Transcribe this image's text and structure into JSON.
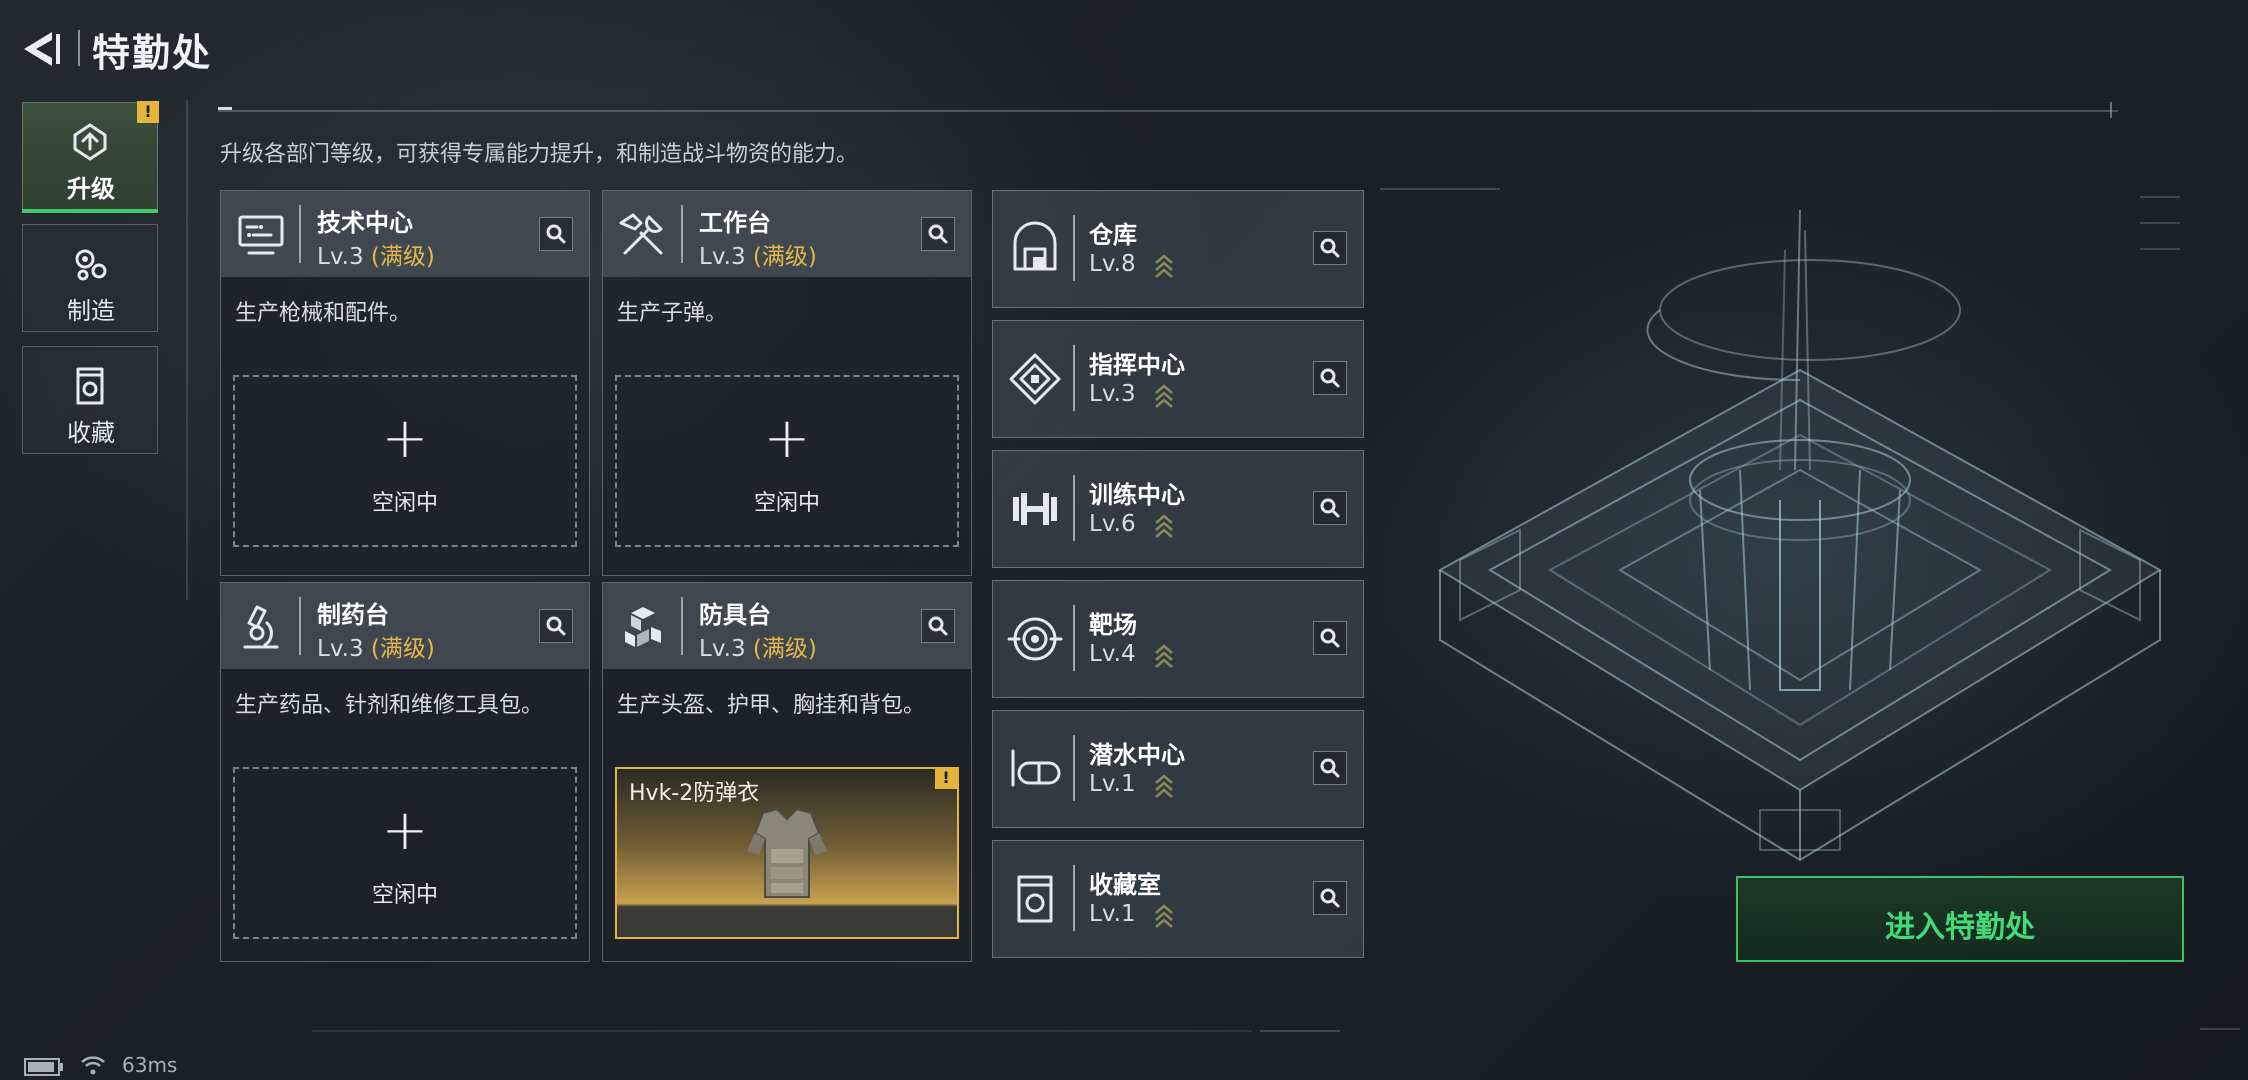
{
  "header": {
    "title": "特勤处"
  },
  "subtitle": "升级各部门等级，可获得专属能力提升，和制造战斗物资的能力。",
  "sidebar": {
    "tabs": [
      {
        "label": "升级",
        "icon": "upgrade-icon",
        "active": true,
        "alert": "!"
      },
      {
        "label": "制造",
        "icon": "gear-icon",
        "active": false
      },
      {
        "label": "收藏",
        "icon": "collection-icon",
        "active": false
      }
    ]
  },
  "departments": [
    {
      "name": "技术中心",
      "level": "Lv.3",
      "max_label": "(满级)",
      "desc": "生产枪械和配件。",
      "icon": "monitor-icon",
      "slot": {
        "plus": "+",
        "label": "空闲中"
      }
    },
    {
      "name": "工作台",
      "level": "Lv.3",
      "max_label": "(满级)",
      "desc": "生产子弹。",
      "icon": "tools-icon",
      "slot": {
        "plus": "+",
        "label": "空闲中"
      }
    },
    {
      "name": "制药台",
      "level": "Lv.3",
      "max_label": "(满级)",
      "desc": "生产药品、针剂和维修工具包。",
      "icon": "microscope-icon",
      "slot": {
        "plus": "+",
        "label": "空闲中"
      }
    },
    {
      "name": "防具台",
      "level": "Lv.3",
      "max_label": "(满级)",
      "desc": "生产头盔、护甲、胸挂和背包。",
      "icon": "armor-blocks-icon",
      "item": {
        "name": "Hvk-2防弹衣",
        "alert": "!"
      }
    }
  ],
  "facilities": [
    {
      "name": "仓库",
      "level": "Lv.8",
      "icon": "warehouse-icon"
    },
    {
      "name": "指挥中心",
      "level": "Lv.3",
      "icon": "command-icon"
    },
    {
      "name": "训练中心",
      "level": "Lv.6",
      "icon": "dumbbell-icon"
    },
    {
      "name": "靶场",
      "level": "Lv.4",
      "icon": "target-icon"
    },
    {
      "name": "潜水中心",
      "level": "Lv.1",
      "icon": "diving-mask-icon"
    },
    {
      "name": "收藏室",
      "level": "Lv.1",
      "icon": "collection-room-icon"
    }
  ],
  "enter_button": {
    "label": "进入特勤处"
  },
  "status": {
    "ping": "63ms"
  },
  "colors": {
    "accent_green": "#43c76b",
    "max_level_gold": "#e5b84a",
    "alert_yellow": "#e3b53a"
  }
}
